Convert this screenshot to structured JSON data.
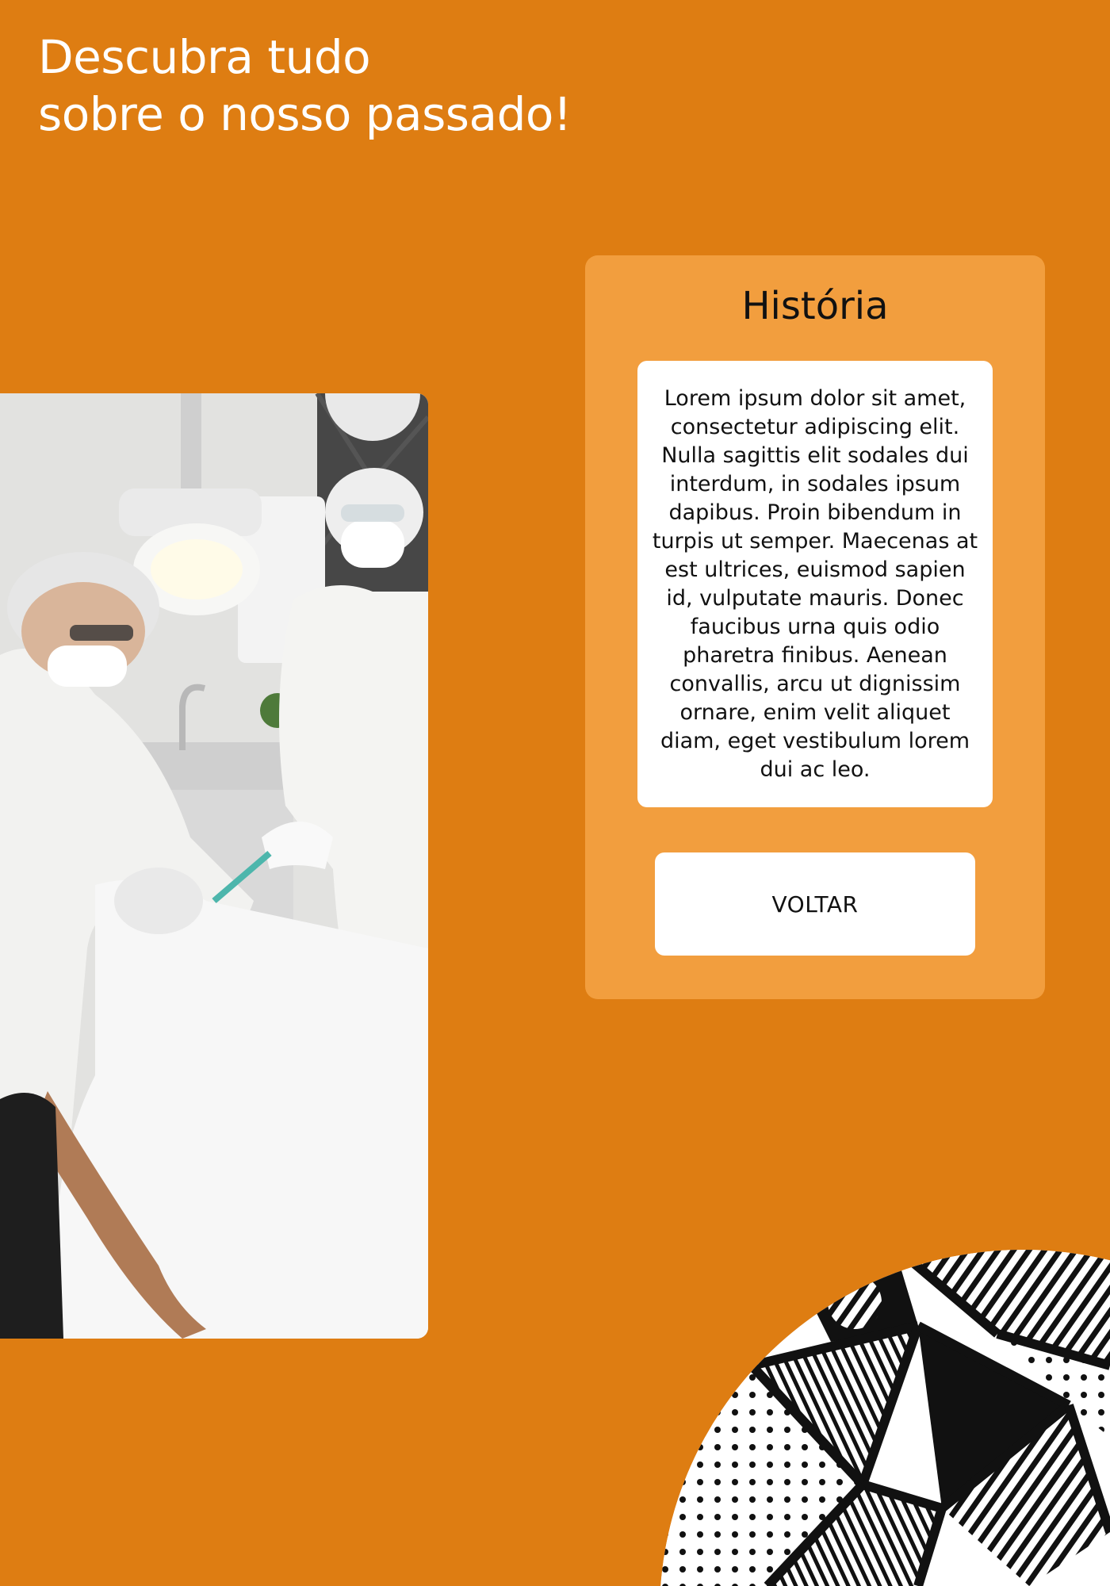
{
  "header": {
    "title_line1": "Descubra tudo",
    "title_line2": "sobre o nosso passado!"
  },
  "card": {
    "title": "História",
    "body": "Lorem ipsum dolor sit amet, consectetur adipiscing elit. Nulla sagittis elit sodales dui interdum, in sodales ipsum dapibus. Proin bibendum in turpis ut semper. Maecenas at est ultrices, euismod sapien id, vulputate mauris. Donec faucibus urna quis odio pharetra finibus. Aenean convallis, arcu ut dignissim ornare, enim velit aliquet diam, eget vestibulum lorem dui ac leo.",
    "button_label": "VOLTAR"
  },
  "colors": {
    "background": "#DE7D12",
    "card": "#F29E3E",
    "panel": "#FFFFFF",
    "text": "#111111"
  },
  "images": {
    "photo": "dental-clinic-photo",
    "pattern": "black-white-tribal-pattern"
  }
}
